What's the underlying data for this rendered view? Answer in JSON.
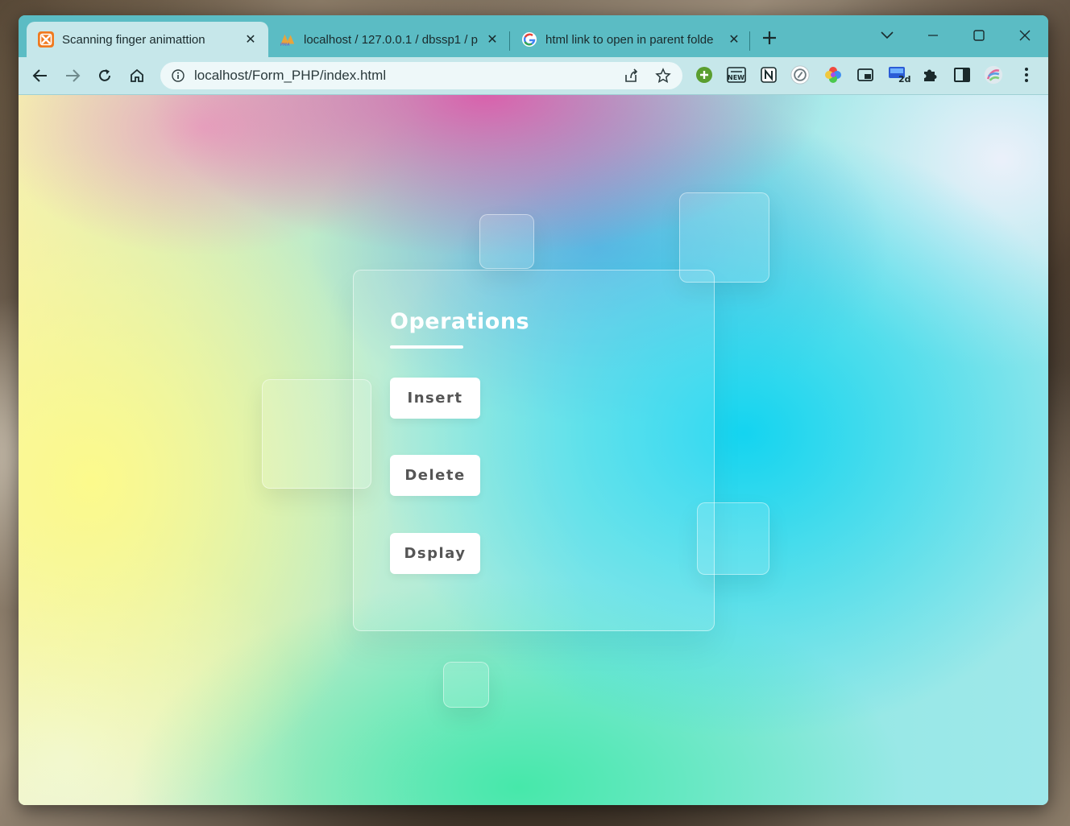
{
  "browser": {
    "tabs": [
      {
        "title": "Scanning finger animattion",
        "icon": "xampp-icon",
        "active": true
      },
      {
        "title": "localhost / 127.0.0.1 / dbssp1 / p",
        "icon": "phpmyadmin-icon",
        "active": false
      },
      {
        "title": "html link to open in parent folde",
        "icon": "google-icon",
        "active": false
      }
    ],
    "address": {
      "url": "localhost/Form_PHP/index.html"
    },
    "extension_badge": "2d",
    "extension_new": "NEW"
  },
  "page": {
    "card": {
      "heading": "Operations",
      "buttons": [
        {
          "label": "Insert"
        },
        {
          "label": "Delete"
        },
        {
          "label": "Dsplay"
        }
      ]
    }
  },
  "colors": {
    "frame": "#5bbcc4",
    "toolbar": "#c6e7ea",
    "button_text": "#555555"
  }
}
